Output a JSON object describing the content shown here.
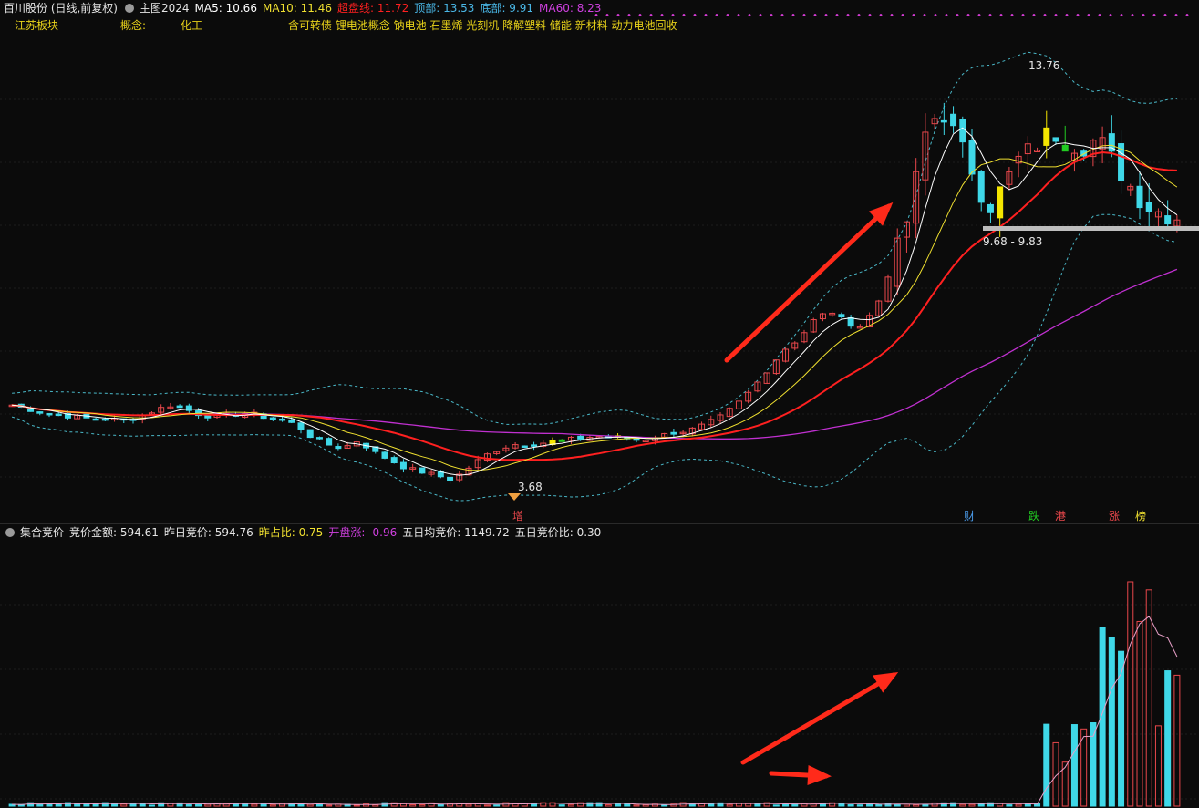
{
  "header": {
    "stock_name": "百川股份 (日线,前复权)",
    "indicator_name": "主图2024",
    "ma5": "MA5: 10.66",
    "ma10": "MA10: 11.46",
    "overbought": "超盘线: 11.72",
    "top": "顶部: 13.53",
    "bottom": "底部: 9.91",
    "ma60": "MA60: 8.23"
  },
  "concepts": {
    "sector": "江苏板块",
    "concept_label": "概念:",
    "industry": "化工",
    "tags": "含可转债 锂电池概念 钠电池 石墨烯 光刻机 降解塑料 储能 新材料 动力电池回收"
  },
  "subchart_header": {
    "title": "集合竞价",
    "amount": "竞价金额: 594.61",
    "prev": "昨日竞价: 594.76",
    "ratio": "昨占比: 0.75",
    "open_rise": "开盘涨: -0.96",
    "avg5": "五日均竞价: 1149.72",
    "ratio5": "五日竞价比: 0.30"
  },
  "annotations": {
    "high_label": "13.76",
    "low_label": "3.68",
    "range_label": "9.68 - 9.83",
    "event_markers": [
      "增",
      "财",
      "跌",
      "港",
      "涨",
      "榜"
    ]
  },
  "colors": {
    "up": "#e8474b",
    "down": "#3fd8e8",
    "ma5": "#ffffff",
    "ma10": "#f0e030",
    "overbought": "#ff2020",
    "ma60": "#c030d0",
    "band": "#4ab8c8",
    "signal_yellow": "#f5e600",
    "signal_green": "#22cc22",
    "arrow": "#ff2a1a"
  },
  "chart_data": [
    {
      "type": "candlestick",
      "title": "主图2024",
      "series": [
        {
          "name": "MA5",
          "values": [
            10.66
          ]
        },
        {
          "name": "MA10",
          "values": [
            11.46
          ]
        },
        {
          "name": "超盘线",
          "values": [
            11.72
          ]
        },
        {
          "name": "MA60",
          "values": [
            8.23
          ]
        }
      ],
      "ylim": [
        3.0,
        15.0
      ],
      "close_path": [
        5.6,
        5.5,
        5.4,
        5.35,
        5.3,
        5.25,
        5.25,
        5.2,
        5.3,
        5.45,
        5.6,
        5.5,
        5.35,
        5.3,
        5.35,
        5.4,
        5.3,
        5.25,
        5.1,
        4.8,
        4.6,
        4.5,
        4.7,
        4.4,
        4.2,
        4.0,
        3.9,
        3.8,
        3.7,
        4.0,
        4.3,
        4.5,
        4.6,
        4.6,
        4.65,
        4.7,
        4.75,
        4.8,
        4.8,
        4.75,
        4.7,
        4.8,
        4.9,
        4.95,
        5.1,
        5.3,
        5.6,
        6.0,
        6.5,
        7.0,
        7.3,
        7.8,
        8.0,
        7.7,
        7.6,
        8.2,
        9.3,
        10.5,
        12.5,
        13.2,
        12.4,
        11.6,
        10.6,
        11.2,
        11.9,
        12.2,
        12.6,
        12.3,
        12.2,
        12.4,
        11.8,
        11.2,
        10.7,
        10.5,
        10.4
      ],
      "annotations": [
        "13.76",
        "3.68",
        "9.68 - 9.83"
      ]
    },
    {
      "type": "bar",
      "title": "集合竞价",
      "series": [
        {
          "name": "竞价金额",
          "values": [
            594.61
          ]
        }
      ],
      "five_day_avg": 1149.72
    }
  ]
}
